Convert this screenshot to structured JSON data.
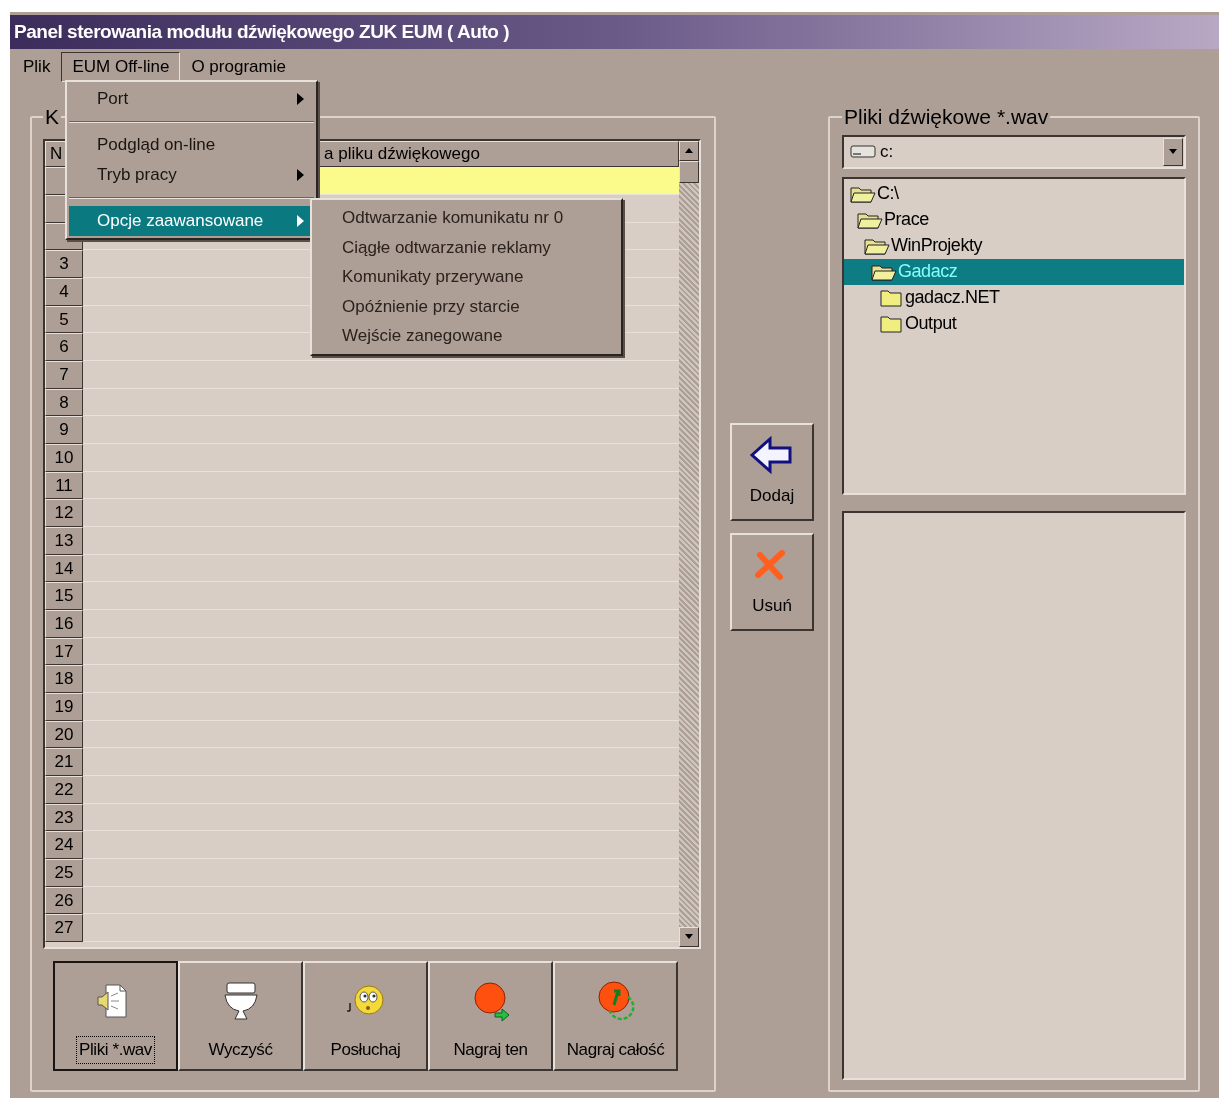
{
  "window": {
    "title": "Panel sterowania modułu dźwiękowego ZUK EUM ( Auto )"
  },
  "menu_bar": [
    {
      "label": "Plik",
      "selected": false
    },
    {
      "label": "EUM Off-line",
      "selected": true
    },
    {
      "label": "O programie",
      "selected": false
    }
  ],
  "dropdown_menu": [
    {
      "kind": "item",
      "label": "Port",
      "submenu": true,
      "selected": false
    },
    {
      "kind": "separator"
    },
    {
      "kind": "item",
      "label": "Podgląd on-line",
      "submenu": false,
      "selected": false
    },
    {
      "kind": "item",
      "label": "Tryb pracy",
      "submenu": true,
      "selected": false
    },
    {
      "kind": "separator"
    },
    {
      "kind": "item",
      "label": "Opcje zaawansowane",
      "submenu": true,
      "selected": true
    }
  ],
  "submenu": [
    "Odtwarzanie komunikatu nr 0",
    "Ciągłe odtwarzanie reklamy",
    "Komunikaty przerywane",
    "Opóźnienie przy starcie",
    "Wejście zanegowane"
  ],
  "left_group": {
    "title": "K",
    "table": {
      "columns": [
        "N",
        "a pliku dźwiękowego"
      ],
      "rows": [
        {
          "selected": true
        },
        {
          "selected": false
        },
        {
          "selected": false
        },
        {
          "number": "3",
          "selected": false
        },
        {
          "number": "4",
          "selected": false
        },
        {
          "number": "5",
          "selected": false
        },
        {
          "number": "6",
          "selected": false
        },
        {
          "number": "7",
          "selected": false
        },
        {
          "number": "8",
          "selected": false
        },
        {
          "number": "9",
          "selected": false
        },
        {
          "number": "10",
          "selected": false
        },
        {
          "number": "11",
          "selected": false
        },
        {
          "number": "12",
          "selected": false
        },
        {
          "number": "13",
          "selected": false
        },
        {
          "number": "14",
          "selected": false
        },
        {
          "number": "15",
          "selected": false
        },
        {
          "number": "16",
          "selected": false
        },
        {
          "number": "17",
          "selected": false
        },
        {
          "number": "18",
          "selected": false
        },
        {
          "number": "19",
          "selected": false
        },
        {
          "number": "20",
          "selected": false
        },
        {
          "number": "21",
          "selected": false
        },
        {
          "number": "22",
          "selected": false
        },
        {
          "number": "23",
          "selected": false
        },
        {
          "number": "24",
          "selected": false
        },
        {
          "number": "25",
          "selected": false
        },
        {
          "number": "26",
          "selected": false
        },
        {
          "number": "27",
          "selected": false
        }
      ]
    },
    "toolbar": [
      {
        "kind": "files",
        "label": "Pliki *.wav",
        "focused": true
      },
      {
        "kind": "clear",
        "label": "Wyczyść",
        "focused": false
      },
      {
        "kind": "listen",
        "label": "Posłuchaj",
        "focused": false
      },
      {
        "kind": "record",
        "label": "Nagraj ten",
        "focused": false
      },
      {
        "kind": "recordall",
        "label": "Nagraj całość",
        "focused": false
      }
    ]
  },
  "middle_buttons": [
    {
      "kind": "add",
      "label": "Dodaj"
    },
    {
      "kind": "remove",
      "label": "Usuń"
    }
  ],
  "right_group": {
    "title": "Pliki dźwiękowe *.wav",
    "drive": "c:",
    "folders": [
      {
        "label": "C:\\",
        "expanded": true,
        "selected": false,
        "children": [
          {
            "label": "Prace",
            "expanded": true,
            "selected": false,
            "children": [
              {
                "label": "WinProjekty",
                "expanded": true,
                "selected": false,
                "children": [
                  {
                    "label": "Gadacz",
                    "expanded": true,
                    "selected": true,
                    "children": [
                      {
                        "label": "gadacz.NET",
                        "expanded": false,
                        "selected": false
                      },
                      {
                        "label": "Output",
                        "expanded": false,
                        "selected": false
                      }
                    ]
                  }
                ]
              }
            ]
          }
        ]
      }
    ]
  }
}
